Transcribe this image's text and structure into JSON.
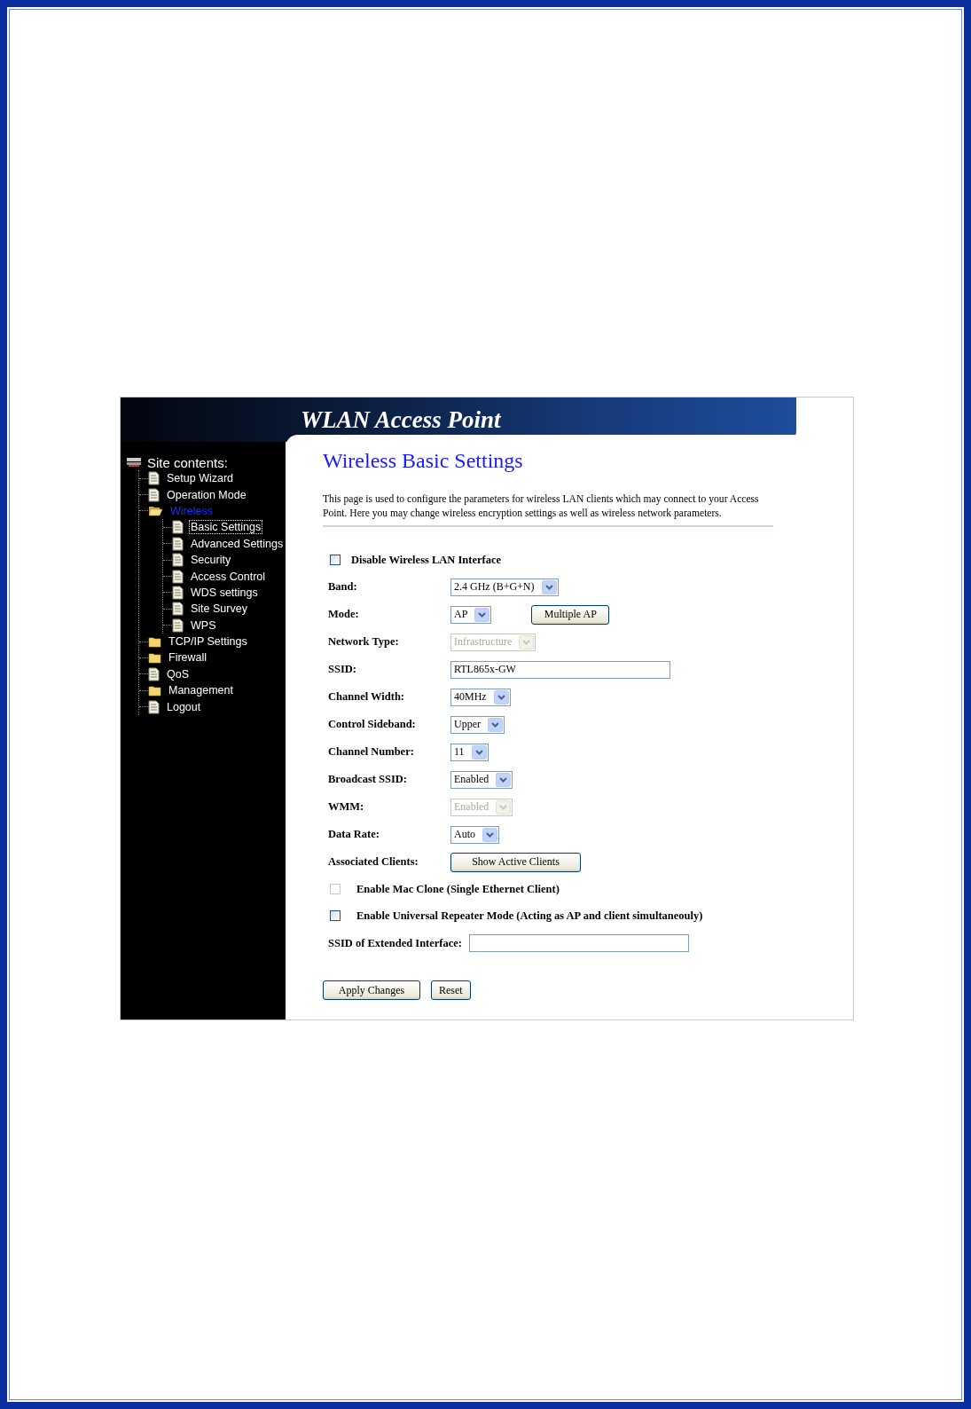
{
  "header": {
    "title": "WLAN Access Point"
  },
  "sidebar": {
    "heading": "Site contents:",
    "items": [
      {
        "label": "Setup Wizard",
        "kind": "page",
        "selected": false,
        "focused": false
      },
      {
        "label": "Operation Mode",
        "kind": "page",
        "selected": false,
        "focused": false
      },
      {
        "label": "Wireless",
        "kind": "folder",
        "selected": true,
        "focused": false,
        "children": [
          {
            "label": "Basic Settings",
            "kind": "page",
            "selected": false,
            "focused": true
          },
          {
            "label": "Advanced Settings",
            "kind": "page",
            "selected": false,
            "focused": false
          },
          {
            "label": "Security",
            "kind": "page",
            "selected": false,
            "focused": false
          },
          {
            "label": "Access Control",
            "kind": "page",
            "selected": false,
            "focused": false
          },
          {
            "label": "WDS settings",
            "kind": "page",
            "selected": false,
            "focused": false
          },
          {
            "label": "Site Survey",
            "kind": "page",
            "selected": false,
            "focused": false
          },
          {
            "label": "WPS",
            "kind": "page",
            "selected": false,
            "focused": false
          }
        ]
      },
      {
        "label": "TCP/IP Settings",
        "kind": "folder",
        "selected": false,
        "focused": false
      },
      {
        "label": "Firewall",
        "kind": "folder",
        "selected": false,
        "focused": false
      },
      {
        "label": "QoS",
        "kind": "page",
        "selected": false,
        "focused": false
      },
      {
        "label": "Management",
        "kind": "folder",
        "selected": false,
        "focused": false
      },
      {
        "label": "Logout",
        "kind": "page",
        "selected": false,
        "focused": false
      }
    ]
  },
  "main": {
    "title": "Wireless Basic Settings",
    "description": "This page is used to configure the parameters for wireless LAN clients which may connect to your Access Point. Here you may change wireless encryption settings as well as wireless network parameters.",
    "disable_wireless": {
      "label": "Disable Wireless LAN Interface",
      "checked": false
    },
    "fields": [
      {
        "kind": "select",
        "label": "Band:",
        "value": "2.4 GHz (B+G+N)",
        "disabled": false
      },
      {
        "kind": "select",
        "label": "Mode:",
        "value": "AP",
        "disabled": false,
        "button": "Multiple AP"
      },
      {
        "kind": "select",
        "label": "Network Type:",
        "value": "Infrastructure",
        "disabled": true
      },
      {
        "kind": "text",
        "label": "SSID:",
        "value": "RTL865x-GW",
        "disabled": false
      },
      {
        "kind": "select",
        "label": "Channel Width:",
        "value": "40MHz",
        "disabled": false
      },
      {
        "kind": "select",
        "label": "Control Sideband:",
        "value": "Upper",
        "disabled": false
      },
      {
        "kind": "select",
        "label": "Channel Number:",
        "value": "11",
        "disabled": false
      },
      {
        "kind": "select",
        "label": "Broadcast SSID:",
        "value": "Enabled",
        "disabled": false
      },
      {
        "kind": "select",
        "label": "WMM:",
        "value": "Enabled",
        "disabled": true
      },
      {
        "kind": "select",
        "label": "Data Rate:",
        "value": "Auto",
        "disabled": false
      },
      {
        "kind": "button",
        "label": "Associated Clients:",
        "button": "Show Active Clients"
      }
    ],
    "options": [
      {
        "label": "Enable Mac Clone (Single Ethernet Client)",
        "checked": false,
        "disabled": true
      },
      {
        "label": "Enable Universal Repeater Mode (Acting as AP and client simultaneouly)",
        "checked": false,
        "disabled": false
      }
    ],
    "extended_ssid": {
      "label": "SSID of Extended Interface:"
    },
    "buttons": [
      "Apply Changes",
      "Reset"
    ]
  }
}
